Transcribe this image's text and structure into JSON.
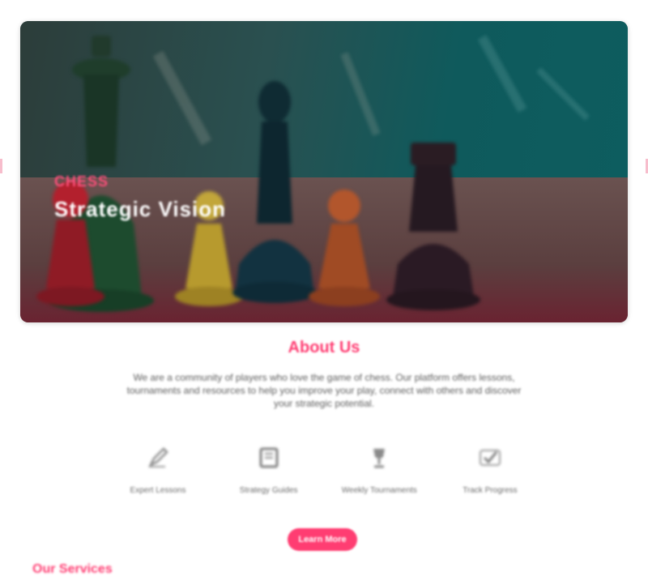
{
  "hero": {
    "eyebrow": "Chess",
    "title": "Strategic Vision",
    "image_alt": "chess-pieces-photo"
  },
  "about": {
    "heading": "About Us",
    "body": "We are a community of players who love the game of chess. Our platform offers lessons, tournaments and resources to help you improve your play, connect with others and discover your strategic potential."
  },
  "features": [
    {
      "icon": "pen-icon",
      "label": "Expert Lessons"
    },
    {
      "icon": "book-icon",
      "label": "Strategy Guides"
    },
    {
      "icon": "trophy-icon",
      "label": "Weekly Tournaments"
    },
    {
      "icon": "check-icon",
      "label": "Track Progress"
    }
  ],
  "cta": {
    "label": "Learn More"
  },
  "next_section": {
    "heading": "Our Services"
  },
  "colors": {
    "accent": "#ff3d72",
    "text_muted": "#6b6b6b",
    "icon": "#8a8a8a"
  }
}
